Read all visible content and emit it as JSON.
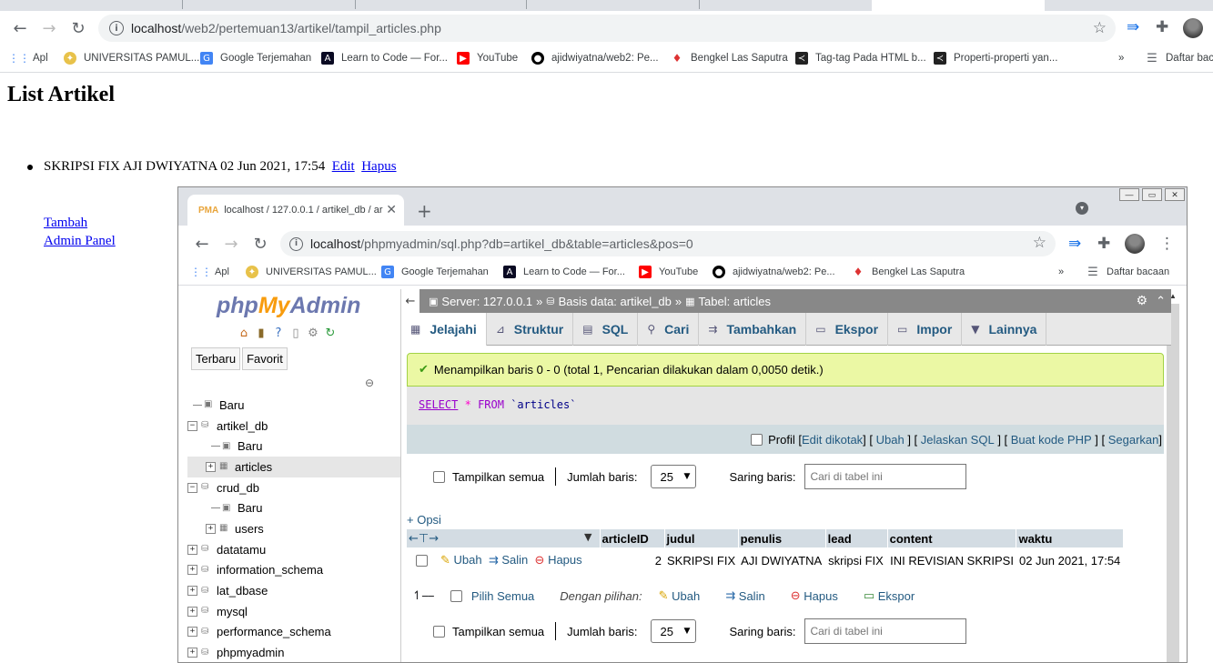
{
  "browser": {
    "url_host": "localhost",
    "url_path": "/web2/pertemuan13/artikel/tampil_articles.php",
    "bookmarks": [
      "Apl",
      "UNIVERSITAS PAMUL...",
      "Google Terjemahan",
      "Learn to Code — For...",
      "YouTube",
      "ajidwiyatna/web2: Pe...",
      "Bengkel Las Saputra",
      "Tag-tag Pada HTML b...",
      "Properti-properti yan..."
    ],
    "more": "»",
    "reading_list": "Daftar bac"
  },
  "page": {
    "title": "List Artikel",
    "article_text": "SKRIPSI FIX AJI DWIYATNA 02 Jun 2021, 17:54",
    "edit_link": "Edit",
    "delete_link": "Hapus",
    "add_link": "Tambah",
    "admin_link": "Admin Panel"
  },
  "shot": {
    "tab_title": "localhost / 127.0.0.1 / artikel_db / ar",
    "tab_favicon": "PMA",
    "url_host": "localhost",
    "url_path": "/phpmyadmin/sql.php?db=artikel_db&table=articles&pos=0",
    "bookmarks": [
      "Apl",
      "UNIVERSITAS PAMUL...",
      "Google Terjemahan",
      "Learn to Code — For...",
      "YouTube",
      "ajidwiyatna/web2: Pe...",
      "Bengkel Las Saputra"
    ],
    "more": "»",
    "reading_list": "Daftar bacaan"
  },
  "pma": {
    "logo": {
      "a": "php",
      "b": "My",
      "c": "Admin"
    },
    "side_tabs": [
      "Terbaru",
      "Favorit"
    ],
    "tree": [
      {
        "label": "Baru",
        "level": 0,
        "toggle": "",
        "icon": "new-icon"
      },
      {
        "label": "artikel_db",
        "level": 0,
        "toggle": "−",
        "icon": "database-icon"
      },
      {
        "label": "Baru",
        "level": 1,
        "toggle": "",
        "icon": "new-icon"
      },
      {
        "label": "articles",
        "level": 1,
        "toggle": "+",
        "icon": "table-icon",
        "selected": true
      },
      {
        "label": "crud_db",
        "level": 0,
        "toggle": "−",
        "icon": "database-icon"
      },
      {
        "label": "Baru",
        "level": 1,
        "toggle": "",
        "icon": "new-icon"
      },
      {
        "label": "users",
        "level": 1,
        "toggle": "+",
        "icon": "table-icon"
      },
      {
        "label": "datatamu",
        "level": 0,
        "toggle": "+",
        "icon": "database-icon"
      },
      {
        "label": "information_schema",
        "level": 0,
        "toggle": "+",
        "icon": "database-icon"
      },
      {
        "label": "lat_dbase",
        "level": 0,
        "toggle": "+",
        "icon": "database-icon"
      },
      {
        "label": "mysql",
        "level": 0,
        "toggle": "+",
        "icon": "database-icon"
      },
      {
        "label": "performance_schema",
        "level": 0,
        "toggle": "+",
        "icon": "database-icon"
      },
      {
        "label": "phpmyadmin",
        "level": 0,
        "toggle": "+",
        "icon": "database-icon"
      }
    ],
    "breadcrumb": {
      "server": "Server: 127.0.0.1",
      "db": "Basis data: artikel_db",
      "table": "Tabel: articles",
      "sep": "»"
    },
    "menu": [
      "Jelajahi",
      "Struktur",
      "SQL",
      "Cari",
      "Tambahkan",
      "Ekspor",
      "Impor",
      "Lainnya"
    ],
    "success": "Menampilkan baris 0 - 0 (total 1, Pencarian dilakukan dalam 0,0050 detik.)",
    "sql": {
      "select": "SELECT",
      "star": "*",
      "from": "FROM",
      "table": "`articles`"
    },
    "sql_tools": {
      "profile": "Profil",
      "edit_inline": "Edit dikotak",
      "edit": "Ubah",
      "explain": "Jelaskan SQL",
      "php": "Buat kode PHP",
      "refresh": "Segarkan"
    },
    "nav": {
      "show_all": "Tampilkan semua",
      "rows_label": "Jumlah baris:",
      "rows_value": "25",
      "filter_label": "Saring baris:",
      "filter_placeholder": "Cari di tabel ini"
    },
    "options": "+ Opsi",
    "columns": [
      "articleID",
      "judul",
      "penulis",
      "lead",
      "content",
      "waktu"
    ],
    "row": {
      "edit": "Ubah",
      "copy": "Salin",
      "delete": "Hapus",
      "values": [
        "2",
        "SKRIPSI FIX",
        "AJI DWIYATNA",
        "skripsi FIX",
        "INI REVISIAN SKRIPSI",
        "02 Jun 2021, 17:54"
      ]
    },
    "bulk": {
      "check_all": "Pilih Semua",
      "with_selected": "Dengan pilihan:",
      "edit": "Ubah",
      "copy": "Salin",
      "delete": "Hapus",
      "export": "Ekspor"
    }
  }
}
